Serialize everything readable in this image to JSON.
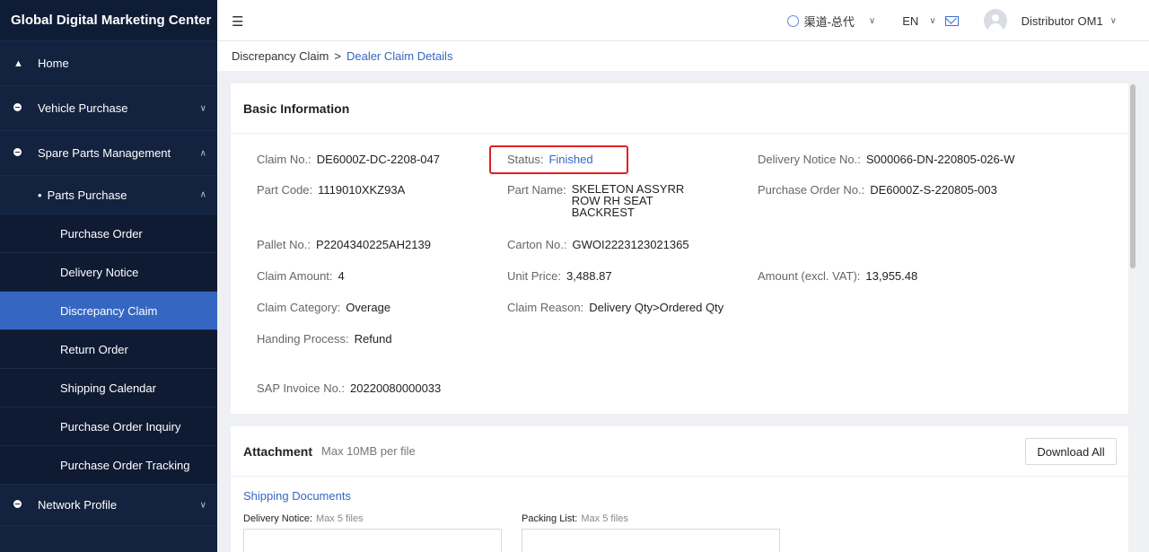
{
  "app": {
    "title": "Global Digital Marketing Center"
  },
  "sidebar": {
    "home": "Home",
    "vehicle_purchase": "Vehicle Purchase",
    "spare_parts": "Spare Parts Management",
    "parts_purchase": "Parts Purchase",
    "leaves": [
      "Purchase Order",
      "Delivery Notice",
      "Discrepancy Claim",
      "Return Order",
      "Shipping Calendar",
      "Purchase Order Inquiry",
      "Purchase Order Tracking"
    ],
    "active_leaf": "Discrepancy Claim",
    "network_profile": "Network Profile"
  },
  "header": {
    "channel": "渠道-总代",
    "language": "EN",
    "user": "Distributor OM1"
  },
  "breadcrumb": {
    "parent": "Discrepancy Claim",
    "separator": ">",
    "current": "Dealer Claim Details"
  },
  "basic": {
    "title": "Basic Information",
    "claim_no": {
      "label": "Claim No.:",
      "value": "DE6000Z-DC-2208-047"
    },
    "status": {
      "label": "Status:",
      "value": "Finished"
    },
    "delivery_notice_no": {
      "label": "Delivery Notice No.:",
      "value": "S000066-DN-220805-026-W"
    },
    "part_code": {
      "label": "Part Code:",
      "value": "1119010XKZ93A"
    },
    "part_name": {
      "label": "Part Name:",
      "value": "SKELETON ASSYRR\nROW RH SEAT\nBACKREST"
    },
    "purchase_order_no": {
      "label": "Purchase Order No.:",
      "value": "DE6000Z-S-220805-003"
    },
    "pallet_no": {
      "label": "Pallet No.:",
      "value": "P2204340225AH2139"
    },
    "carton_no": {
      "label": "Carton No.:",
      "value": "GWOI2223123021365"
    },
    "claim_amount": {
      "label": "Claim Amount:",
      "value": "4"
    },
    "unit_price": {
      "label": "Unit Price:",
      "value": "3,488.87"
    },
    "amount_excl_vat": {
      "label": "Amount (excl. VAT):",
      "value": "13,955.48"
    },
    "claim_category": {
      "label": "Claim Category:",
      "value": "Overage"
    },
    "claim_reason": {
      "label": "Claim Reason:",
      "value": "Delivery Qty>Ordered Qty"
    },
    "handing_process": {
      "label": "Handing Process:",
      "value": "Refund"
    },
    "sap_invoice_no": {
      "label": "SAP Invoice No.:",
      "value": "20220080000033"
    }
  },
  "attachment": {
    "title": "Attachment",
    "subtitle": "Max 10MB per file",
    "download_all": "Download All",
    "shipping_documents": "Shipping Documents",
    "delivery_notice": {
      "label": "Delivery Notice:",
      "hint": "Max 5 files"
    },
    "packing_list": {
      "label": "Packing List:",
      "hint": "Max 5 files"
    }
  }
}
